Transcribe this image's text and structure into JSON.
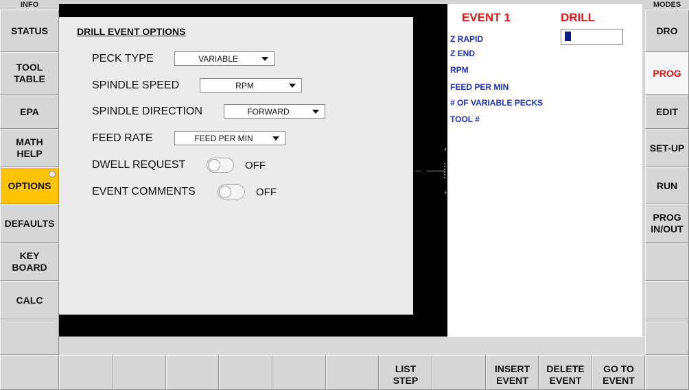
{
  "left_column": {
    "header": "INFO",
    "buttons": [
      {
        "label": "STATUS"
      },
      {
        "label": "TOOL\nTABLE"
      },
      {
        "label": "EPA"
      },
      {
        "label": "MATH\nHELP"
      },
      {
        "label": "OPTIONS"
      },
      {
        "label": "DEFAULTS"
      },
      {
        "label": "KEY\nBOARD"
      },
      {
        "label": "CALC"
      },
      {
        "label": ""
      }
    ]
  },
  "right_column": {
    "header": "MODES",
    "buttons": [
      {
        "label": "DRO"
      },
      {
        "label": "PROG"
      },
      {
        "label": "EDIT"
      },
      {
        "label": "SET-UP"
      },
      {
        "label": "RUN"
      },
      {
        "label": "PROG\nIN/OUT"
      },
      {
        "label": ""
      },
      {
        "label": ""
      },
      {
        "label": ""
      }
    ]
  },
  "options_panel": {
    "title": "DRILL EVENT OPTIONS",
    "peck_type": {
      "label": "PECK TYPE",
      "value": "VARIABLE"
    },
    "spindle_speed": {
      "label": "SPINDLE SPEED",
      "value": "RPM"
    },
    "spindle_direction": {
      "label": "SPINDLE DIRECTION",
      "value": "FORWARD"
    },
    "feed_rate": {
      "label": "FEED RATE",
      "value": "FEED PER MIN"
    },
    "dwell_request": {
      "label": "DWELL REQUEST",
      "state": "OFF"
    },
    "event_comments": {
      "label": "EVENT COMMENTS",
      "state": "OFF"
    }
  },
  "event_panel": {
    "event_number": "EVENT 1",
    "event_type": "DRILL",
    "fields": [
      "Z RAPID",
      "Z END",
      "RPM",
      "FEED PER MIN",
      "# OF VARIABLE PECKS",
      "TOOL #"
    ]
  },
  "bottom_bar": {
    "buttons": [
      {
        "label": ""
      },
      {
        "label": ""
      },
      {
        "label": ""
      },
      {
        "label": ""
      },
      {
        "label": ""
      },
      {
        "label": ""
      },
      {
        "label": ""
      },
      {
        "label": "LIST\nSTEP"
      },
      {
        "label": ""
      },
      {
        "label": "INSERT\nEVENT"
      },
      {
        "label": "DELETE\nEVENT"
      },
      {
        "label": "GO TO\nEVENT"
      },
      {
        "label": ""
      }
    ]
  },
  "colors": {
    "active_yellow": "#ffc400",
    "event_red": "#e01818",
    "field_blue": "#1c2fb5"
  }
}
